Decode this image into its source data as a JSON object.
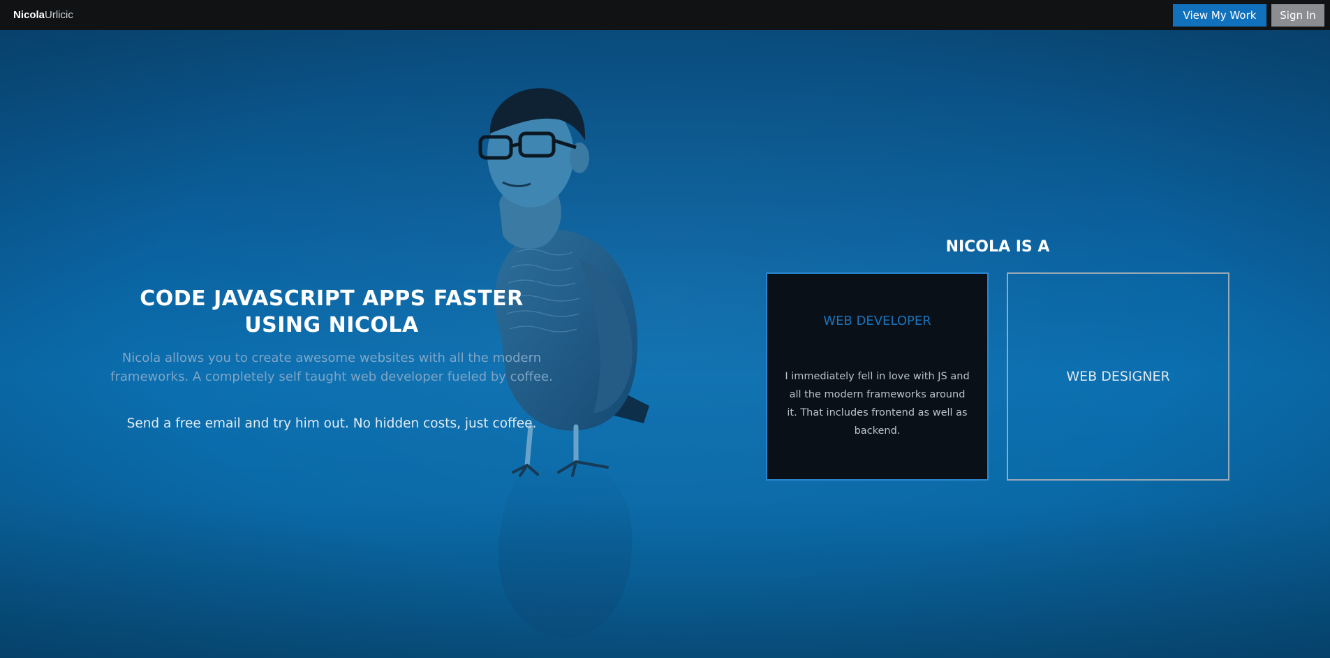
{
  "topbar": {
    "brand_first": "Nicola",
    "brand_last": "Urlicic",
    "view_work_label": "View My Work",
    "sign_in_label": "Sign In"
  },
  "hero": {
    "headline_line1": "CODE JAVASCRIPT APPS FASTER",
    "headline_line2": "USING NICOLA",
    "lead": "Nicola allows you to create awesome websites with all the modern frameworks. A completely self taught web developer fueled by coffee.",
    "cta": "Send a free email and try him out. No hidden costs, just coffee."
  },
  "roles": {
    "title": "NICOLA IS A",
    "cards": [
      {
        "title": "WEB DEVELOPER",
        "text": "I immediately fell in love with JS and all the modern frameworks around it. That includes frontend as well as backend."
      },
      {
        "title": "WEB DESIGNER"
      }
    ]
  },
  "colors": {
    "topbar_bg": "#111214",
    "primary_button": "#1271bd",
    "secondary_button": "#8b8d90",
    "hero_blue": "#0a5f9b",
    "card_dark": "#0a1017",
    "accent_text": "#1a74bd"
  }
}
